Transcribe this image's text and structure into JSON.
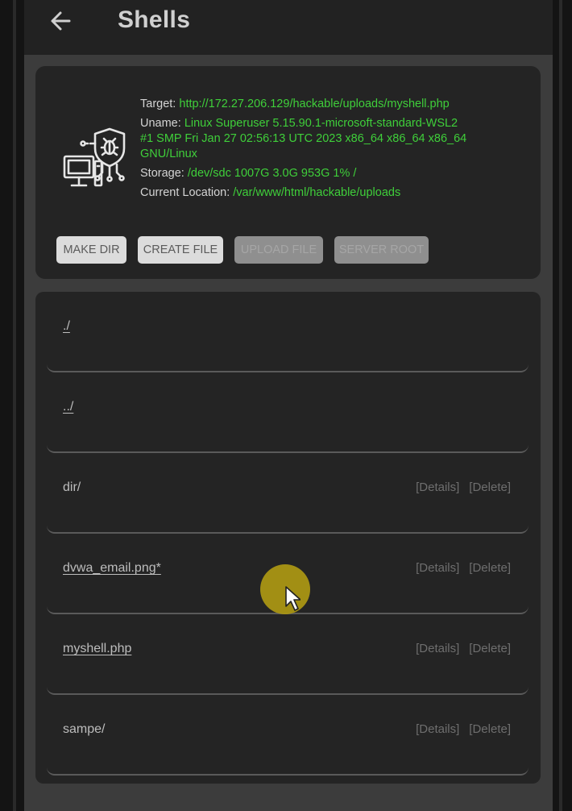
{
  "appbar": {
    "title": "Shells",
    "back_icon": "arrow-left-icon"
  },
  "info": {
    "icon": "server-bug-shield-icon",
    "target_label": "Target:",
    "target_value": "http://172.27.206.129/hackable/uploads/myshell.php",
    "uname_label": "Uname:",
    "uname_line1": "Linux Superuser 5.15.90.1-microsoft-standard-WSL2",
    "uname_line2": "#1 SMP Fri Jan 27 02:56:13 UTC 2023 x86_64 x86_64 x86_64",
    "uname_line3": "GNU/Linux",
    "storage_label": "Storage:",
    "storage_value": "/dev/sdc 1007G 3.0G 953G 1% /",
    "location_label": "Current Location:",
    "location_value": "/var/www/html/hackable/uploads"
  },
  "buttons": {
    "make_dir": "MAKE DIR",
    "create_file": "CREATE FILE",
    "upload_file": "UPLOAD FILE",
    "server_root": "SERVER ROOT"
  },
  "files": [
    {
      "name": "./",
      "details": "",
      "delete": ""
    },
    {
      "name": "../",
      "details": "",
      "delete": ""
    },
    {
      "name": "dir/",
      "details": "[Details]",
      "delete": "[Delete]"
    },
    {
      "name": "dvwa_email.png*",
      "details": "[Details]",
      "delete": "[Delete]"
    },
    {
      "name": "myshell.php",
      "details": "[Details]",
      "delete": "[Delete]"
    },
    {
      "name": "sampe/",
      "details": "[Details]",
      "delete": "[Delete]"
    }
  ],
  "colors": {
    "accent_green": "#3fcf3a",
    "card_bg": "#242424",
    "screen_bg": "#3c3c3c",
    "appbar_bg": "#222222"
  }
}
